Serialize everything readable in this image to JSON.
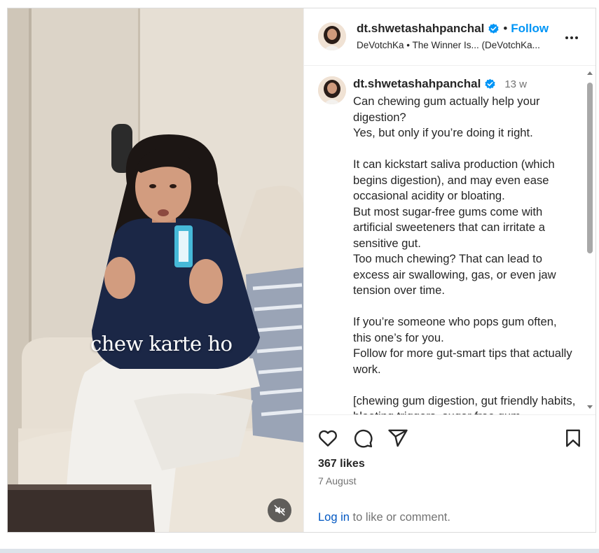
{
  "media": {
    "overlay_text": "chew karte ho",
    "mute_icon": "speaker-muted-icon"
  },
  "header": {
    "username": "dt.shwetashahpanchal",
    "separator": "•",
    "follow_label": "Follow",
    "audio_text": "DeVotchKa • The Winner Is... (DeVotchKa...",
    "more_icon": "more-horizontal-icon"
  },
  "caption": {
    "username": "dt.shwetashahpanchal",
    "time": "13 w",
    "text": "Can chewing gum actually help your digestion?\nYes, but only if you’re doing it right.\n\nIt can kickstart saliva production (which begins digestion), and may even ease occasional acidity or bloating.\nBut most sugar-free gums come with artificial sweeteners that can irritate a sensitive gut.\nToo much chewing? That can lead to excess air swallowing, gas, or even jaw tension over time.\n\nIf you’re someone who pops gum often, this one’s for you.\nFollow for more gut-smart tips that actually work.\n\n[chewing gum digestion, gut friendly habits, bloating triggers, sugar free gum"
  },
  "actions": {
    "likes": "367 likes",
    "date": "7 August",
    "login_link": "Log in",
    "login_rest": " to like or comment."
  },
  "colors": {
    "accent": "#0095f6",
    "verified": "#0095f6",
    "link": "#0057c2",
    "muted_text": "#737373"
  }
}
